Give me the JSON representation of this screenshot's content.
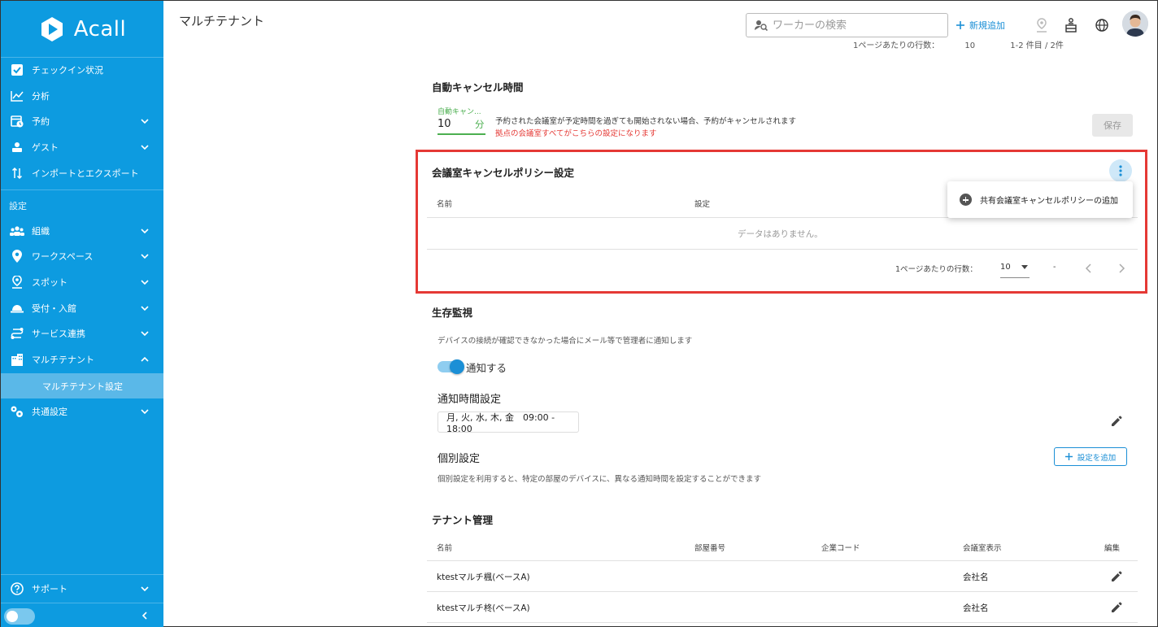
{
  "sidebar": {
    "logo": "Acall",
    "items": [
      {
        "label": "チェックイン状況"
      },
      {
        "label": "分析"
      },
      {
        "label": "予約"
      },
      {
        "label": "ゲスト"
      },
      {
        "label": "インポートとエクスポート"
      }
    ],
    "settings_label": "設定",
    "settings_items": [
      {
        "label": "組織"
      },
      {
        "label": "ワークスペース"
      },
      {
        "label": "スポット"
      },
      {
        "label": "受付・入館"
      },
      {
        "label": "サービス連携"
      },
      {
        "label": "マルチテナント"
      }
    ],
    "sub_item": "マルチテナント設定",
    "common": "共通設定",
    "support": "サポート"
  },
  "header": {
    "title": "マルチテナント",
    "search_placeholder": "ワーカーの検索",
    "new_add": "新規追加"
  },
  "top_pager": {
    "label": "1ページあたりの行数：",
    "value": "10",
    "range": "1-2 件目 / 2件"
  },
  "auto_cancel": {
    "title": "自動キャンセル時間",
    "field_label": "自動キャン...",
    "field_value": "10",
    "field_unit": "分",
    "desc": "予約された会議室が予定時間を過ぎても開始されない場合、予約がキャンセルされます",
    "note": "拠点の会議室すべてがこちらの設定になります",
    "save": "保存"
  },
  "policy": {
    "title": "会議室キャンセルポリシー設定",
    "menu_item": "共有会議室キャンセルポリシーの追加",
    "col_name": "名前",
    "col_setting": "設定",
    "no_data": "データはありません。",
    "rows_label": "1ページあたりの行数：",
    "rows_value": "10",
    "range": "-"
  },
  "monitor": {
    "title": "生存監視",
    "desc": "デバイスの接続が確認できなかった場合にメール等で管理者に通知します",
    "toggle_label": "通知する",
    "time_title": "通知時間設定",
    "time_value": "月, 火, 水, 木, 金　09:00 - 18:00",
    "individual_title": "個別設定",
    "add_button": "設定を追加",
    "individual_desc": "個別設定を利用すると、特定の部屋のデバイスに、異なる通知時間を設定することができます"
  },
  "tenant": {
    "title": "テナント管理",
    "columns": [
      "名前",
      "部屋番号",
      "企業コード",
      "会議室表示",
      "編集"
    ],
    "rows": [
      {
        "name": "ktestマルチ楓(ベースA)",
        "display": "会社名"
      },
      {
        "name": "ktestマルチ柊(ベースA)",
        "display": "会社名"
      }
    ]
  },
  "colors": {
    "sidebar": "#0d9be0",
    "accent": "#1b8fd6",
    "highlight": "#e53935",
    "success": "#4caf50"
  }
}
